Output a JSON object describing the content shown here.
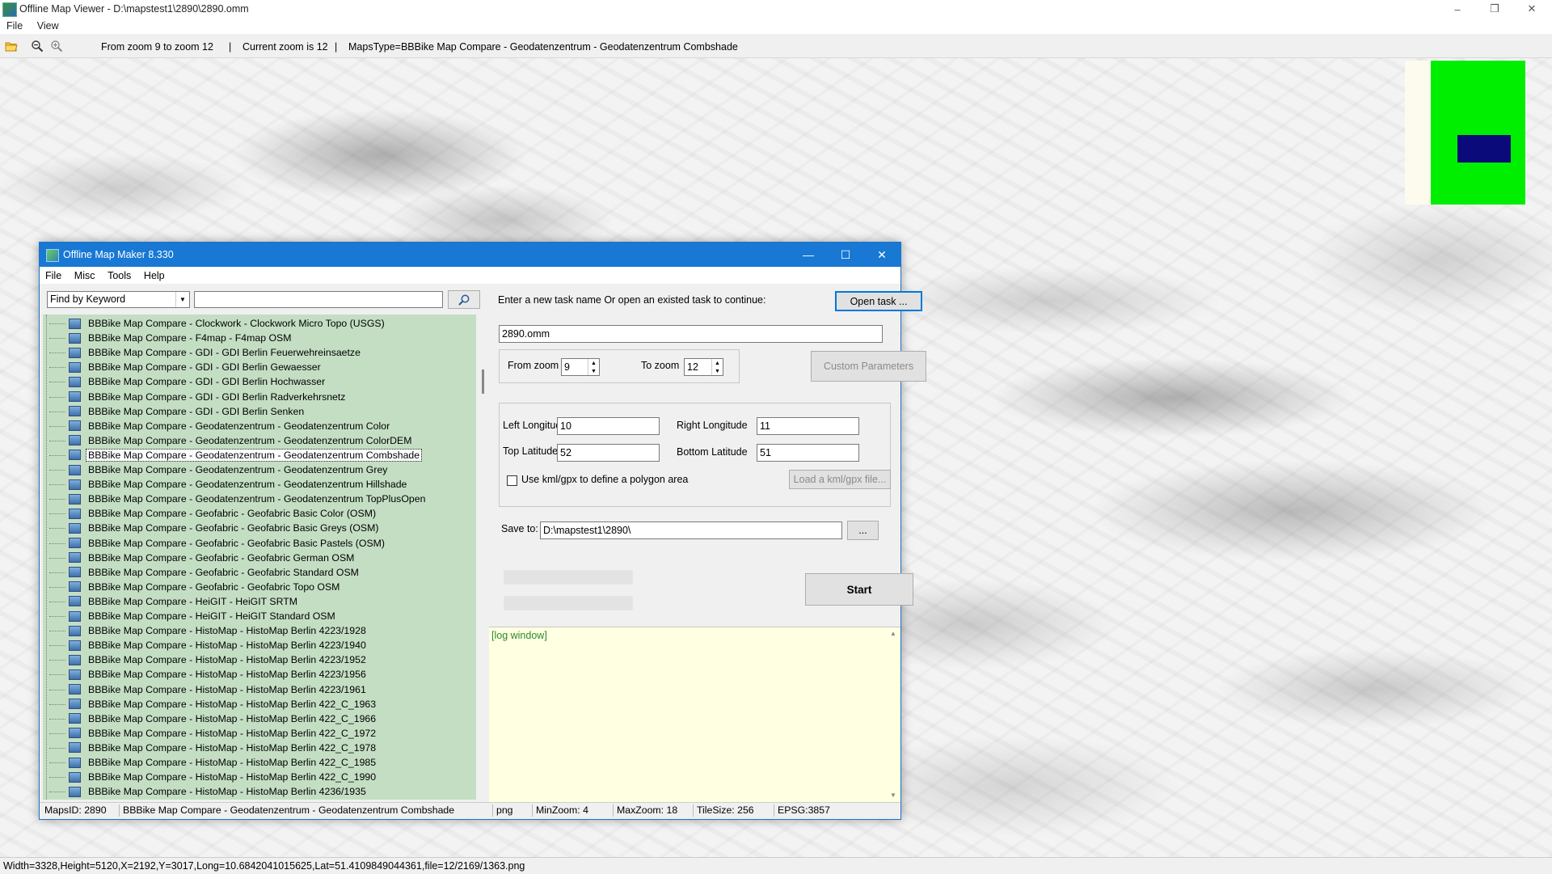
{
  "window": {
    "title": "Offline Map Viewer - D:\\mapstest1\\2890\\2890.omm",
    "controls": [
      "–",
      "❐",
      "✕"
    ]
  },
  "menu": [
    "File",
    "View"
  ],
  "toolbar": {
    "zoom_range": "From zoom 9 to zoom 12",
    "current_zoom": "Current zoom is 12",
    "maps_type": "MapsType=BBBike Map Compare - Geodatenzentrum - Geodatenzentrum Combshade",
    "separator": "|",
    "icons": [
      "open-folder-icon",
      "zoom-out-icon",
      "zoom-in-icon"
    ]
  },
  "overview_colors": {
    "background": "#fdfbee",
    "coverage": "#00ee00",
    "viewport": "#0a0a7a"
  },
  "status": "Width=3328,Height=5120,X=2192,Y=3017,Long=10.6842041015625,Lat=51.4109849044361,file=12/2169/1363.png",
  "dialog": {
    "title": "Offline Map Maker 8.330",
    "controls": [
      "—",
      "☐",
      "✕"
    ],
    "menu": [
      "File",
      "Misc",
      "Tools",
      "Help"
    ],
    "search": {
      "mode": "Find by Keyword",
      "value": "",
      "button_icon": "search-icon"
    },
    "tree_items": [
      "BBBike Map Compare - Clockwork - Clockwork Micro Topo (USGS)",
      "BBBike Map Compare - F4map - F4map OSM",
      "BBBike Map Compare - GDI - GDI Berlin Feuerwehreinsaetze",
      "BBBike Map Compare - GDI - GDI Berlin Gewaesser",
      "BBBike Map Compare - GDI - GDI Berlin Hochwasser",
      "BBBike Map Compare - GDI - GDI Berlin Radverkehrsnetz",
      "BBBike Map Compare - GDI - GDI Berlin Senken",
      "BBBike Map Compare - Geodatenzentrum - Geodatenzentrum Color",
      "BBBike Map Compare - Geodatenzentrum - Geodatenzentrum ColorDEM",
      "BBBike Map Compare - Geodatenzentrum - Geodatenzentrum Combshade",
      "BBBike Map Compare - Geodatenzentrum - Geodatenzentrum Grey",
      "BBBike Map Compare - Geodatenzentrum - Geodatenzentrum Hillshade",
      "BBBike Map Compare - Geodatenzentrum - Geodatenzentrum TopPlusOpen",
      "BBBike Map Compare - Geofabric - Geofabric Basic Color (OSM)",
      "BBBike Map Compare - Geofabric - Geofabric Basic Greys (OSM)",
      "BBBike Map Compare - Geofabric - Geofabric Basic Pastels (OSM)",
      "BBBike Map Compare - Geofabric - Geofabric German OSM",
      "BBBike Map Compare - Geofabric - Geofabric Standard OSM",
      "BBBike Map Compare - Geofabric - Geofabric Topo OSM",
      "BBBike Map Compare - HeiGIT - HeiGIT SRTM",
      "BBBike Map Compare - HeiGIT - HeiGIT Standard OSM",
      "BBBike Map Compare - HistoMap - HistoMap Berlin 4223/1928",
      "BBBike Map Compare - HistoMap - HistoMap Berlin 4223/1940",
      "BBBike Map Compare - HistoMap - HistoMap Berlin 4223/1952",
      "BBBike Map Compare - HistoMap - HistoMap Berlin 4223/1956",
      "BBBike Map Compare - HistoMap - HistoMap Berlin 4223/1961",
      "BBBike Map Compare - HistoMap - HistoMap Berlin 422_C_1963",
      "BBBike Map Compare - HistoMap - HistoMap Berlin 422_C_1966",
      "BBBike Map Compare - HistoMap - HistoMap Berlin 422_C_1972",
      "BBBike Map Compare - HistoMap - HistoMap Berlin 422_C_1978",
      "BBBike Map Compare - HistoMap - HistoMap Berlin 422_C_1985",
      "BBBike Map Compare - HistoMap - HistoMap Berlin 422_C_1990",
      "BBBike Map Compare - HistoMap - HistoMap Berlin 4236/1935"
    ],
    "selected_item": "BBBike Map Compare - Geodatenzentrum - Geodatenzentrum Combshade",
    "task_prompt": "Enter a new task name Or open an existed task to continue:",
    "open_task_label": "Open task ...",
    "task_name": "2890.omm",
    "from_zoom_label": "From zoom",
    "from_zoom": "9",
    "to_zoom_label": "To zoom",
    "to_zoom": "12",
    "custom_params_label": "Custom Parameters",
    "left_lon_label": "Left Longitude",
    "left_lon": "10",
    "right_lon_label": "Right Longitude",
    "right_lon": "11",
    "top_lat_label": "Top Latitude",
    "top_lat": "52",
    "bottom_lat_label": "Bottom Latitude",
    "bottom_lat": "51",
    "kml_label": "Use kml/gpx to define a polygon area",
    "kml_checked": false,
    "load_kml_label": "Load a kml/gpx file...",
    "save_to_label": "Save to:",
    "save_to": "D:\\mapstest1\\2890\\",
    "browse_label": "...",
    "start_label": "Start",
    "log_text": "[log window]",
    "status": {
      "maps_id": "MapsID: 2890",
      "map_name": "BBBike Map Compare - Geodatenzentrum - Geodatenzentrum Combshade",
      "format": "png",
      "min_zoom": "MinZoom: 4",
      "max_zoom": "MaxZoom: 18",
      "tile_size": "TileSize: 256",
      "epsg": "EPSG:3857"
    }
  }
}
